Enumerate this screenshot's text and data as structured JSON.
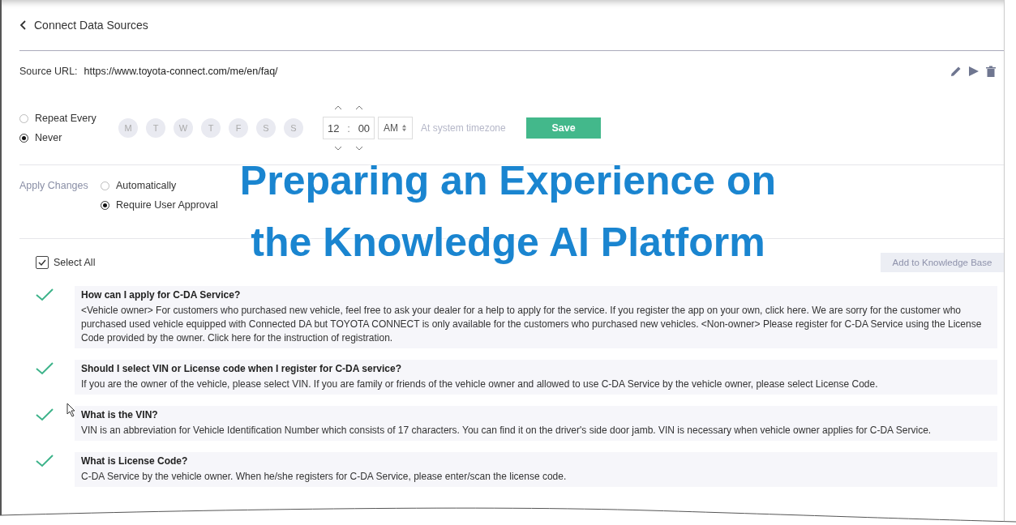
{
  "header": {
    "title": "Connect Data Sources"
  },
  "source": {
    "label": "Source URL:",
    "url": "https://www.toyota-connect.com/me/en/faq/"
  },
  "schedule": {
    "options": [
      {
        "label": "Repeat Every",
        "selected": false
      },
      {
        "label": "Never",
        "selected": true
      }
    ],
    "days": [
      "M",
      "T",
      "W",
      "T",
      "F",
      "S",
      "S"
    ],
    "hour": "12",
    "separator": ":",
    "minute": "00",
    "meridiem": "AM",
    "timezone_note": "At system timezone",
    "save": "Save"
  },
  "apply_changes": {
    "label": "Apply Changes",
    "options": [
      {
        "label": "Automatically",
        "selected": false
      },
      {
        "label": "Require User Approval",
        "selected": true
      }
    ]
  },
  "select_all": {
    "label": "Select All",
    "checked": true
  },
  "add_button": {
    "label": "Add to Knowledge Base",
    "disabled": true
  },
  "faqs": [
    {
      "checked": true,
      "question": "How can I apply for C-DA Service?",
      "answer": "<Vehicle owner> For customers who purchased new vehicle, feel free to ask your dealer for a help to apply for the service. If you register the app on your own, click here. We are sorry for the customer who purchased used vehicle equipped with Connected DA but TOYOTA CONNECT is only available for the customers who purchased new vehicles. <Non-owner> Please register for C-DA Service using the License Code provided by the owner. Click here for the instruction of registration."
    },
    {
      "checked": true,
      "question": "Should I select VIN or License code when I register for C-DA service?",
      "answer": "If you are the owner of the vehicle, please select VIN. If you are family or friends of the vehicle owner and allowed to use C-DA Service by the vehicle owner, please select License Code."
    },
    {
      "checked": true,
      "question": "What is the VIN?",
      "answer": "VIN is an abbreviation for Vehicle Identification Number which consists of 17 characters. You can find it on the driver's side door jamb. VIN is necessary when vehicle owner applies for C-DA Service."
    },
    {
      "checked": true,
      "question": "What is License Code?",
      "answer": "C-DA Service by the vehicle owner. When he/she registers for C-DA Service, please enter/scan the license code."
    }
  ],
  "overlay_title": [
    "Preparing an Experience on",
    "the Knowledge AI Platform"
  ]
}
